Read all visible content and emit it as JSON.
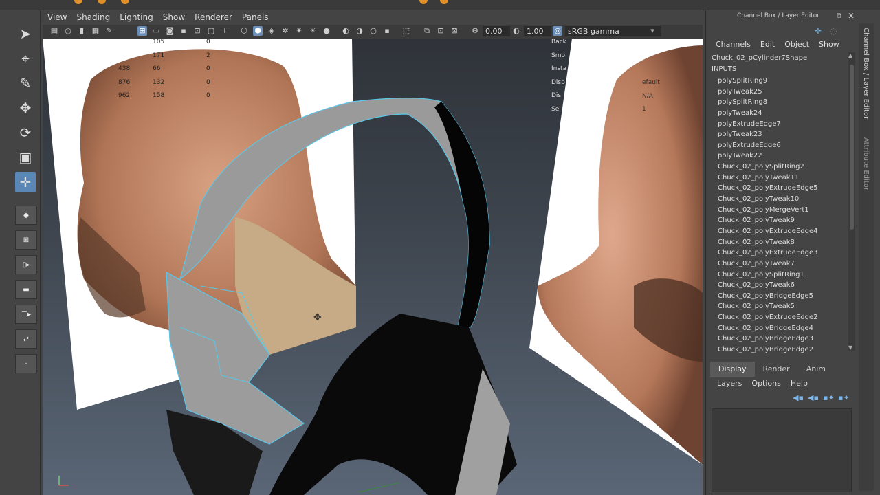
{
  "viewport_menu": [
    "View",
    "Shading",
    "Lighting",
    "Show",
    "Renderer",
    "Panels"
  ],
  "viewport_toolbar": {
    "exposure": "0.00",
    "gamma": "1.00",
    "color_space": "sRGB gamma"
  },
  "hud": {
    "stats": [
      [
        "105",
        "0"
      ],
      [
        "171",
        "2"
      ],
      [
        "438",
        "66",
        "0"
      ],
      [
        "876",
        "132",
        "0"
      ],
      [
        "962",
        "158",
        "0"
      ]
    ],
    "right_labels": [
      "Back",
      "Smo",
      "Insta",
      "Disp",
      "Dis",
      "Sel"
    ],
    "right_values": [
      "efault",
      "N/A",
      "1"
    ]
  },
  "channel_box": {
    "title": "Channel Box / Layer Editor",
    "menu": [
      "Channels",
      "Edit",
      "Object",
      "Show"
    ],
    "node": "Chuck_02_pCylinder7Shape",
    "inputs_label": "INPUTS",
    "inputs": [
      "polySplitRing9",
      "polyTweak25",
      "polySplitRing8",
      "polyTweak24",
      "polyExtrudeEdge7",
      "polyTweak23",
      "polyExtrudeEdge6",
      "polyTweak22",
      "Chuck_02_polySplitRing2",
      "Chuck_02_polyTweak11",
      "Chuck_02_polyExtrudeEdge5",
      "Chuck_02_polyTweak10",
      "Chuck_02_polyMergeVert1",
      "Chuck_02_polyTweak9",
      "Chuck_02_polyExtrudeEdge4",
      "Chuck_02_polyTweak8",
      "Chuck_02_polyExtrudeEdge3",
      "Chuck_02_polyTweak7",
      "Chuck_02_polySplitRing1",
      "Chuck_02_polyTweak6",
      "Chuck_02_polyBridgeEdge5",
      "Chuck_02_polyTweak5",
      "Chuck_02_polyExtrudeEdge2",
      "Chuck_02_polyBridgeEdge4",
      "Chuck_02_polyBridgeEdge3",
      "Chuck_02_polyBridgeEdge2"
    ],
    "side_tab_1": "Channel Box / Layer Editor",
    "side_tab_2": "Attribute Editor"
  },
  "layer_editor": {
    "tabs": [
      "Display",
      "Render",
      "Anim"
    ],
    "menu": [
      "Layers",
      "Options",
      "Help"
    ]
  }
}
